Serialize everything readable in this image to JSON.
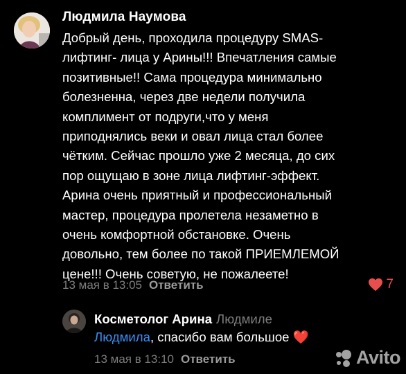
{
  "comment": {
    "author": "Людмила Наумова",
    "text": "Добрый день, проходила процедуру SMAS-\nлифтинг- лица  у Арины!!! Впечатления самые\nпозитивные!! Сама процедура минимально\nболезненна, через две недели получила\nкомплимент от подруги,что у меня\nприподнялись веки и овал лица стал более\nчётким. Сейчас прошло уже  2 месяца, до сих\nпор ощущаю в зоне лица лифтинг-эффект.\nАрина очень приятный и  профессиональный\nмастер, процедура пролетела незаметно в\nочень комфортной обстановке. Очень\nдовольно, тем более по такой ПРИЕМЛЕМОЙ\nцене!!! Очень советую, не пожалеете!",
    "date": "13 мая в 13:05",
    "reply_label": "Ответить",
    "likes": "7",
    "like_color": "#e94e4e"
  },
  "reply": {
    "author": "Косметолог Арина",
    "to": "Людмиле",
    "mention": "Людмила",
    "text": ", спасибо вам большое",
    "emoji": "❤️",
    "date": "13 мая в 13:10",
    "reply_label": "Ответить",
    "mention_color": "#3b8ef5"
  },
  "watermark": {
    "text": "Avito"
  }
}
